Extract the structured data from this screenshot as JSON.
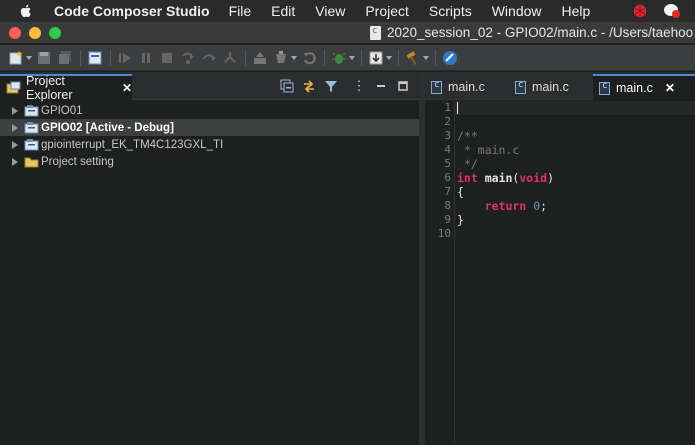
{
  "menubar": {
    "app_name": "Code Composer Studio",
    "items": [
      "File",
      "Edit",
      "View",
      "Project",
      "Scripts",
      "Window",
      "Help"
    ]
  },
  "window": {
    "title": "2020_session_02 - GPIO02/main.c - /Users/taehoo"
  },
  "project_explorer": {
    "tab_label": "Project Explorer",
    "tree": [
      {
        "label": "GPIO01",
        "selected": false
      },
      {
        "label": "GPIO02  [Active - Debug]",
        "selected": true
      },
      {
        "label": "gpiointerrupt_EK_TM4C123GXL_TI",
        "selected": false
      },
      {
        "label": "Project setting",
        "selected": false
      }
    ]
  },
  "editor": {
    "tabs": [
      {
        "label": "main.c",
        "active": false
      },
      {
        "label": "main.c",
        "active": false
      },
      {
        "label": "main.c",
        "active": true
      }
    ],
    "line_numbers": [
      "1",
      "2",
      "3",
      "4",
      "5",
      "6",
      "7",
      "8",
      "9",
      "10"
    ],
    "code": {
      "l3": "/**",
      "l4": " * main.c",
      "l5": " */",
      "l6_kw": "int",
      "l6_name": "main",
      "l6_paren_open": "(",
      "l6_void": "void",
      "l6_paren_close": ")",
      "l7": "{",
      "l8_kw": "return",
      "l8_num": "0",
      "l8_semi": ";",
      "l9": "}"
    }
  },
  "colors": {
    "keyword": "#e0316e",
    "comment": "#7a7a7a",
    "accent": "#4a8ad6"
  }
}
